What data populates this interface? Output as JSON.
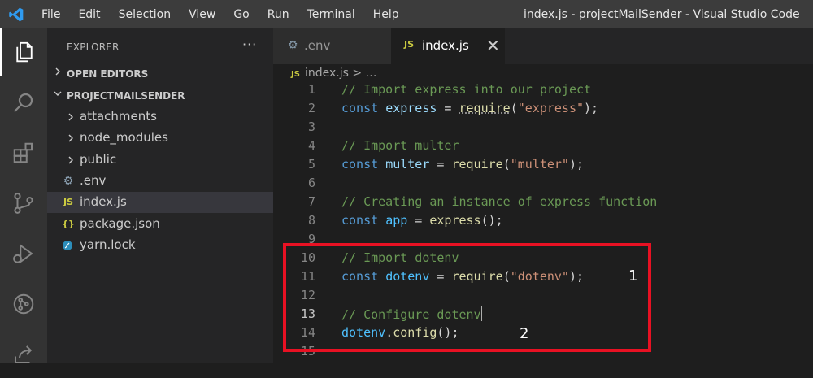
{
  "menu": [
    "File",
    "Edit",
    "Selection",
    "View",
    "Go",
    "Run",
    "Terminal",
    "Help"
  ],
  "window_title": "index.js - projectMailSender - Visual Studio Code",
  "activity_icons": [
    "explorer-icon",
    "search-icon",
    "extensions-icon",
    "source-control-icon",
    "run-debug-icon",
    "remote-icon",
    "share-icon"
  ],
  "sidebar": {
    "title": "EXPLORER",
    "more": "···",
    "open_editors": "OPEN EDITORS",
    "project": "PROJECTMAILSENDER",
    "items": [
      {
        "label": "attachments",
        "type": "folder"
      },
      {
        "label": "node_modules",
        "type": "folder"
      },
      {
        "label": "public",
        "type": "folder"
      },
      {
        "label": ".env",
        "type": "env",
        "icon": "⚙"
      },
      {
        "label": "index.js",
        "type": "js",
        "icon": "JS"
      },
      {
        "label": "package.json",
        "type": "json",
        "icon": "{}"
      },
      {
        "label": "yarn.lock",
        "type": "yarn",
        "icon": "🧶"
      }
    ]
  },
  "tabs": [
    {
      "label": ".env",
      "icon": "⚙"
    },
    {
      "label": "index.js",
      "icon": "JS",
      "close": "✕"
    }
  ],
  "breadcrumb": {
    "icon": "JS",
    "file": "index.js",
    "sep": " > …"
  },
  "code_lines": [
    {
      "n": "1",
      "tokens": [
        [
          "cm",
          "// Import express into our project"
        ]
      ]
    },
    {
      "n": "2",
      "tokens": [
        [
          "kw",
          "const "
        ],
        [
          "vr",
          "express"
        ],
        [
          "pl",
          " = "
        ],
        [
          "fn",
          "require"
        ],
        [
          "pl",
          "("
        ],
        [
          "st",
          "\"express\""
        ],
        [
          "pl",
          ");"
        ]
      ]
    },
    {
      "n": "3",
      "tokens": []
    },
    {
      "n": "4",
      "tokens": [
        [
          "cm",
          "// Import multer"
        ]
      ]
    },
    {
      "n": "5",
      "tokens": [
        [
          "kw",
          "const "
        ],
        [
          "vr",
          "multer"
        ],
        [
          "pl",
          " = "
        ],
        [
          "fn",
          "require"
        ],
        [
          "pl",
          "("
        ],
        [
          "st",
          "\"multer\""
        ],
        [
          "pl",
          ");"
        ]
      ]
    },
    {
      "n": "6",
      "tokens": []
    },
    {
      "n": "7",
      "tokens": [
        [
          "cm",
          "// Creating an instance of express function"
        ]
      ]
    },
    {
      "n": "8",
      "tokens": [
        [
          "kw",
          "const "
        ],
        [
          "cn",
          "app"
        ],
        [
          "pl",
          " = "
        ],
        [
          "fn",
          "express"
        ],
        [
          "pl",
          "();"
        ]
      ]
    },
    {
      "n": "9",
      "tokens": []
    },
    {
      "n": "10",
      "tokens": [
        [
          "cm",
          "// Import dotenv"
        ]
      ]
    },
    {
      "n": "11",
      "tokens": [
        [
          "kw",
          "const "
        ],
        [
          "cn",
          "dotenv"
        ],
        [
          "pl",
          " = "
        ],
        [
          "fn",
          "require"
        ],
        [
          "pl",
          "("
        ],
        [
          "st",
          "\"dotenv\""
        ],
        [
          "pl",
          ");"
        ]
      ]
    },
    {
      "n": "12",
      "tokens": []
    },
    {
      "n": "13",
      "tokens": [
        [
          "cm",
          "// Configure dotenv"
        ]
      ]
    },
    {
      "n": "14",
      "tokens": [
        [
          "cn",
          "dotenv"
        ],
        [
          "pl",
          "."
        ],
        [
          "fn",
          "config"
        ],
        [
          "pl",
          "();"
        ]
      ]
    },
    {
      "n": "15",
      "tokens": []
    }
  ],
  "annotations": [
    "1",
    "2"
  ]
}
